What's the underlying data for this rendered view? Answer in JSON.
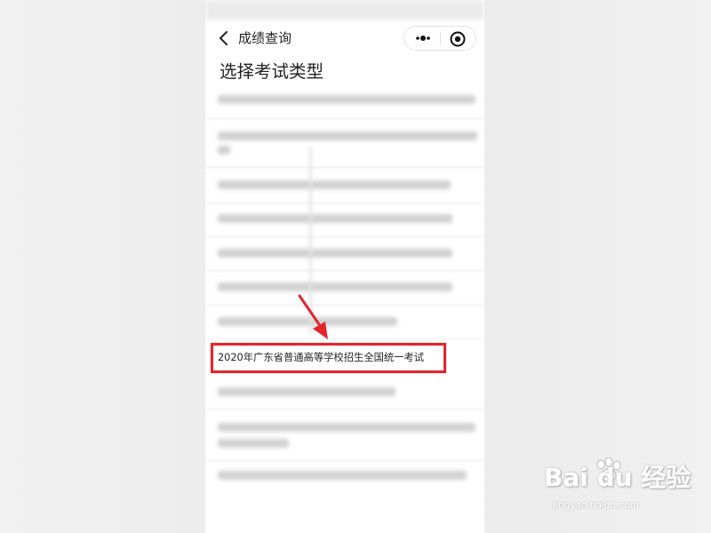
{
  "nav": {
    "title": "成绩查询",
    "back_icon": "chevron-left-icon",
    "more_icon": "more-dots-icon",
    "close_icon": "target-circle-icon"
  },
  "page": {
    "heading": "选择考试类型"
  },
  "exam_list": {
    "highlighted_item": "2020年广东省普通高等学校招生全国统一考试",
    "highlight_color": "#e3262d"
  },
  "watermark": {
    "logo": "Bai du 经验",
    "url": "jingyan.baidu.com"
  }
}
